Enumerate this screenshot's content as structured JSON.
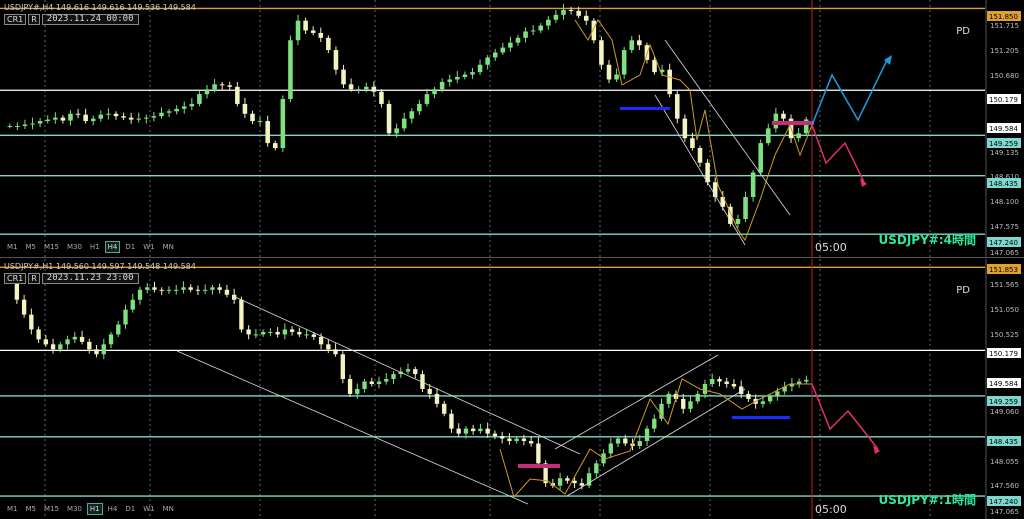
{
  "colors": {
    "bull": "#7fe07f",
    "bear": "#f4f4c0",
    "grid": "#666",
    "orange_line": "#e0a030",
    "white_line": "#ffffff",
    "cyan_line": "#7fd8d0",
    "red_vline": "#c02020",
    "blue_bar": "#1a2cff",
    "magenta_bar": "#c0307a",
    "proj_up": "#1e9be0",
    "proj_down": "#e0306a",
    "orange_zigzag": "#d09a20"
  },
  "panes": [
    {
      "symbol_line": "USDJPY#,H4  149.616 149.616 149.536 149.584",
      "tag_cr": "CR1",
      "tag_r": "R",
      "date": "2023.11.24 00:00",
      "pd_label": "PD",
      "timeframes": [
        "M1",
        "M5",
        "M15",
        "M30",
        "H1",
        "H4",
        "D1",
        "W1",
        "MN"
      ],
      "active_timeframe": "H4",
      "pane_label": "USDJPY#:4時間",
      "time_label": "05:00",
      "price_ticks": [
        "151.715",
        "151.205",
        "150.680",
        "150.179",
        "149.584",
        "149.259",
        "149.135",
        "148.610",
        "148.435",
        "148.100",
        "147.575",
        "147.240",
        "147.065"
      ],
      "price_boxes": [
        {
          "text": "151.850",
          "kind": "orange"
        },
        {
          "text": "150.179",
          "kind": "white"
        },
        {
          "text": "149.584",
          "kind": "current"
        },
        {
          "text": "149.259",
          "kind": "cyan"
        },
        {
          "text": "148.435",
          "kind": "cyan"
        },
        {
          "text": "147.240",
          "kind": "cyan"
        }
      ]
    },
    {
      "symbol_line": "USDJPY#,H1  149.560 149.597 149.548 149.584",
      "tag_cr": "CR1",
      "tag_r": "R",
      "date": "2023.11.23 23:00",
      "pd_label": "PD",
      "timeframes": [
        "M1",
        "M5",
        "M15",
        "M30",
        "H1",
        "H4",
        "D1",
        "W1",
        "MN"
      ],
      "active_timeframe": "H1",
      "pane_label": "USDJPY#:1時間",
      "time_label": "05:00",
      "price_ticks": [
        "151.565",
        "151.050",
        "150.525",
        "150.179",
        "149.584",
        "149.259",
        "149.060",
        "148.435",
        "148.055",
        "147.560",
        "147.065"
      ],
      "price_boxes": [
        {
          "text": "151.853",
          "kind": "orange"
        },
        {
          "text": "150.179",
          "kind": "white"
        },
        {
          "text": "149.584",
          "kind": "current"
        },
        {
          "text": "149.259",
          "kind": "cyan"
        },
        {
          "text": "148.435",
          "kind": "cyan"
        },
        {
          "text": "147.240",
          "kind": "cyan"
        }
      ]
    }
  ],
  "chart_data": [
    {
      "type": "candlestick",
      "symbol": "USDJPY#",
      "timeframe": "H4",
      "ylim": [
        147.06,
        151.9
      ],
      "horizontal_levels": [
        {
          "price": 151.85,
          "color": "orange"
        },
        {
          "price": 150.179,
          "color": "white"
        },
        {
          "price": 149.259,
          "color": "cyan"
        },
        {
          "price": 148.435,
          "color": "cyan"
        },
        {
          "price": 147.24,
          "color": "cyan"
        }
      ],
      "closes": [
        149.45,
        149.45,
        149.48,
        149.5,
        149.55,
        149.58,
        149.62,
        149.56,
        149.7,
        149.68,
        149.55,
        149.6,
        149.68,
        149.7,
        149.65,
        149.62,
        149.58,
        149.6,
        149.62,
        149.65,
        149.72,
        149.75,
        149.8,
        149.85,
        149.9,
        150.1,
        150.2,
        150.3,
        150.28,
        150.25,
        149.9,
        149.7,
        149.55,
        149.55,
        149.1,
        149.0,
        150.0,
        151.2,
        151.6,
        151.4,
        151.35,
        151.25,
        151.0,
        150.6,
        150.3,
        150.2,
        150.2,
        150.25,
        150.15,
        149.9,
        149.3,
        149.4,
        149.6,
        149.75,
        149.9,
        150.1,
        150.2,
        150.35,
        150.4,
        150.45,
        150.5,
        150.55,
        150.7,
        150.85,
        150.95,
        151.05,
        151.15,
        151.25,
        151.38,
        151.4,
        151.5,
        151.62,
        151.72,
        151.82,
        151.8,
        151.7,
        151.6,
        151.2,
        150.7,
        150.4,
        150.5,
        151.0,
        151.2,
        151.1,
        150.8,
        150.55,
        150.6,
        150.1,
        149.6,
        149.2,
        149.0,
        148.7,
        148.3,
        148.0,
        147.8,
        147.45,
        147.55,
        148.0,
        148.5,
        149.1,
        149.4,
        149.7,
        149.6,
        149.2,
        149.3,
        149.584
      ],
      "annotations": [
        "PD",
        "05:00"
      ]
    },
    {
      "type": "candlestick",
      "symbol": "USDJPY#",
      "timeframe": "H1",
      "ylim": [
        147.06,
        151.9
      ],
      "horizontal_levels": [
        {
          "price": 151.853,
          "color": "orange"
        },
        {
          "price": 150.179,
          "color": "white"
        },
        {
          "price": 149.259,
          "color": "cyan"
        },
        {
          "price": 148.435,
          "color": "cyan"
        },
        {
          "price": 147.24,
          "color": "cyan"
        }
      ],
      "closes": [
        151.6,
        151.2,
        150.9,
        150.6,
        150.4,
        150.3,
        150.2,
        150.3,
        150.4,
        150.45,
        150.35,
        150.2,
        150.1,
        150.3,
        150.5,
        150.7,
        151.0,
        151.2,
        151.4,
        151.45,
        151.4,
        151.38,
        151.4,
        151.4,
        151.45,
        151.4,
        151.38,
        151.4,
        151.45,
        151.4,
        151.3,
        151.2,
        150.6,
        150.5,
        150.5,
        150.55,
        150.55,
        150.5,
        150.6,
        150.55,
        150.5,
        150.5,
        150.45,
        150.3,
        150.2,
        150.1,
        149.6,
        149.3,
        149.4,
        149.55,
        149.5,
        149.55,
        149.6,
        149.7,
        149.75,
        149.8,
        149.7,
        149.4,
        149.3,
        149.1,
        148.9,
        148.6,
        148.5,
        148.6,
        148.55,
        148.6,
        148.5,
        148.45,
        148.4,
        148.35,
        148.4,
        148.35,
        148.3,
        147.9,
        147.5,
        147.45,
        147.6,
        147.55,
        147.5,
        147.45,
        147.7,
        147.9,
        148.1,
        148.3,
        148.4,
        148.3,
        148.25,
        148.35,
        148.6,
        148.8,
        149.1,
        149.3,
        149.2,
        149.0,
        149.15,
        149.3,
        149.5,
        149.6,
        149.55,
        149.5,
        149.45,
        149.3,
        149.2,
        149.1,
        149.15,
        149.25,
        149.35,
        149.45,
        149.5,
        149.55,
        149.584
      ],
      "annotations": [
        "PD",
        "05:00"
      ]
    }
  ]
}
